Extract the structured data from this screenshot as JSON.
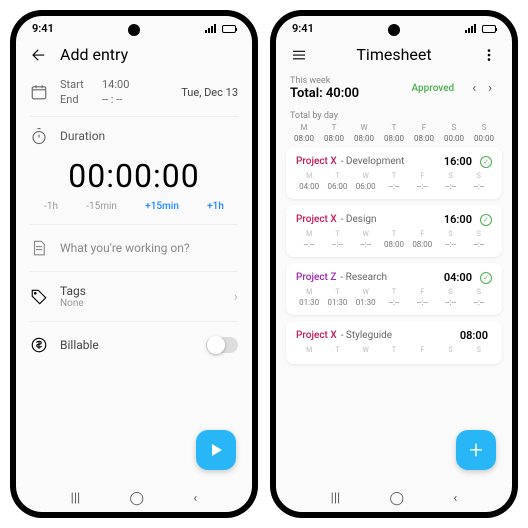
{
  "status_time": "9:41",
  "left": {
    "title": "Add entry",
    "start_label": "Start",
    "start_time": "14:00",
    "end_label": "End",
    "end_time": "-- : --",
    "date": "Tue, Dec 13",
    "duration_label": "Duration",
    "duration_value": "00:00:00",
    "adjust": {
      "m1h": "-1h",
      "m15": "-15min",
      "p15": "+15min",
      "p1h": "+1h"
    },
    "description_placeholder": "What you're working on?",
    "tags_label": "Tags",
    "tags_value": "None",
    "billable_label": "Billable"
  },
  "right": {
    "title": "Timesheet",
    "this_week": "This week",
    "total_label": "Total: 40:00",
    "approved": "Approved",
    "total_by_day": "Total by day",
    "day_letters": [
      "M",
      "T",
      "W",
      "T",
      "F",
      "S",
      "S"
    ],
    "day_totals": [
      "08:00",
      "08:00",
      "08:00",
      "08:00",
      "08:00",
      "00:00",
      "00:00"
    ],
    "cards": [
      {
        "proj": "Project X",
        "task": "Development",
        "time": "16:00",
        "pclass": "proj",
        "vals": [
          "04:00",
          "06:00",
          "06:00",
          "--:--",
          "--:--",
          "--:--",
          "--:--"
        ]
      },
      {
        "proj": "Project X",
        "task": "Design",
        "time": "16:00",
        "pclass": "proj",
        "vals": [
          "--:--",
          "--:--",
          "--:--",
          "08:00",
          "08:00",
          "--:--",
          "--:--"
        ]
      },
      {
        "proj": "Project Z",
        "task": "Research",
        "time": "04:00",
        "pclass": "projz",
        "vals": [
          "01:30",
          "01:30",
          "01:30",
          "--:--",
          "--:--",
          "--:--",
          "--:--"
        ]
      },
      {
        "proj": "Project X",
        "task": "Styleguide",
        "time": "08:00",
        "pclass": "proj",
        "vals": [
          "",
          "",
          "",
          "",
          "",
          "",
          ""
        ]
      }
    ]
  }
}
